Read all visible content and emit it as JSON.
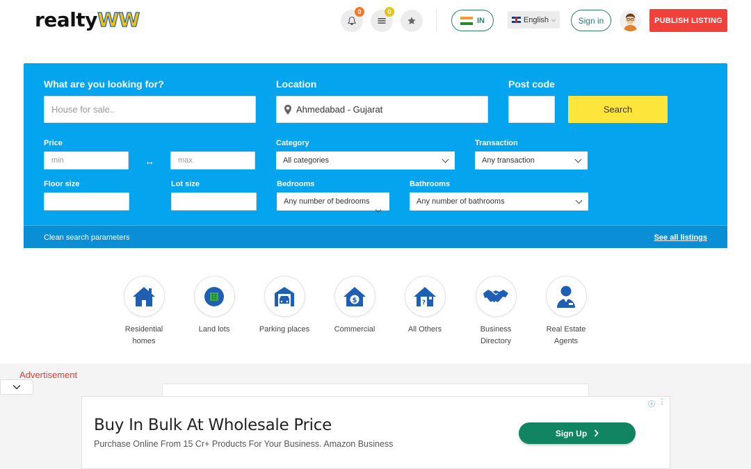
{
  "header": {
    "logo_main": "realty",
    "logo_accent": "WW",
    "notifications_count": "0",
    "listings_count": "0",
    "country": "IN",
    "language": "English",
    "signin_label": "Sign in",
    "publish_label": "PUBLISH LISTING"
  },
  "search": {
    "looking_label": "What are you looking for?",
    "looking_placeholder": "House for sale..",
    "location_label": "Location",
    "location_value": "Ahmedabad - Gujarat",
    "postcode_label": "Post code",
    "search_button": "Search",
    "price_label": "Price",
    "price_min": "min",
    "price_max": "max",
    "category_label": "Category",
    "category_value": "All categories",
    "transaction_label": "Transaction",
    "transaction_value": "Any transaction",
    "floor_label": "Floor size",
    "lot_label": "Lot size",
    "bedrooms_label": "Bedrooms",
    "bedrooms_value": "Any number of bedrooms",
    "bathrooms_label": "Bathrooms",
    "bathrooms_value": "Any number of bathrooms",
    "clean_label": "Clean search parameters",
    "see_all_label": "See all listings"
  },
  "categories": [
    {
      "line1": "Residential",
      "line2": "homes",
      "icon": "house-icon"
    },
    {
      "line1": "Land lots",
      "line2": "",
      "icon": "land-icon"
    },
    {
      "line1": "Parking places",
      "line2": "",
      "icon": "garage-icon"
    },
    {
      "line1": "Commercial",
      "line2": "",
      "icon": "commercial-icon"
    },
    {
      "line1": "All Others",
      "line2": "",
      "icon": "question-house-icon"
    },
    {
      "line1": "Business",
      "line2": "Directory",
      "icon": "handshake-icon"
    },
    {
      "line1": "Real Estate",
      "line2": "Agents",
      "icon": "agent-icon"
    }
  ],
  "ad": {
    "label": "Advertisement",
    "title": "Buy In Bulk At Wholesale Price",
    "subtitle": "Purchase Online From 15 Cr+ Products For Your Business. Amazon Business",
    "cta": "Sign Up"
  },
  "colors": {
    "panel": "#04a4ef",
    "search_button": "#fde53b",
    "publish": "#f0413a",
    "accent_green": "#2a7d6b",
    "icon_blue": "#1e5fb3"
  }
}
